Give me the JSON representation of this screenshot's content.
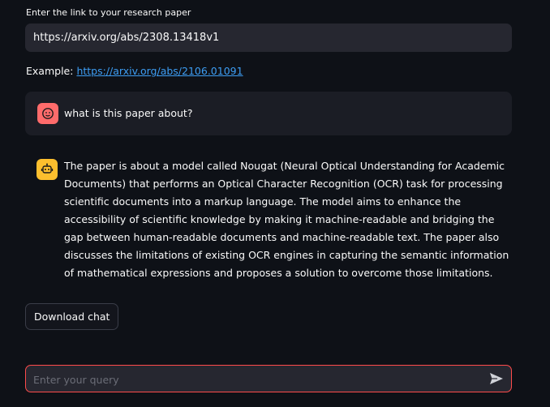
{
  "url_field": {
    "label": "Enter the link to your research paper",
    "value": "https://arxiv.org/abs/2308.13418v1"
  },
  "example": {
    "prefix": "Example:",
    "link_text": "https://arxiv.org/abs/2106.01091"
  },
  "messages": [
    {
      "role": "user",
      "avatar_icon": "user-face-icon",
      "text": "what is this paper about?"
    },
    {
      "role": "assistant",
      "avatar_icon": "robot-icon",
      "text": "The paper is about a model called Nougat (Neural Optical Understanding for Academic Documents) that performs an Optical Character Recognition (OCR) task for processing scientific documents into a markup language. The model aims to enhance the accessibility of scientific knowledge by making it machine-readable and bridging the gap between human-readable documents and machine-readable text. The paper also discusses the limitations of existing OCR engines in capturing the semantic information of mathematical expressions and proposes a solution to overcome those limitations."
    }
  ],
  "download_button": {
    "label": "Download chat"
  },
  "chat_input": {
    "placeholder": "Enter your query",
    "send_icon": "send-icon"
  },
  "colors": {
    "background": "#0e1117",
    "input_bg": "#262730",
    "user_avatar": "#ff6b6b",
    "bot_avatar": "#fcbf2e",
    "link": "#3d9df3",
    "focus_border": "#ff4b4b"
  }
}
